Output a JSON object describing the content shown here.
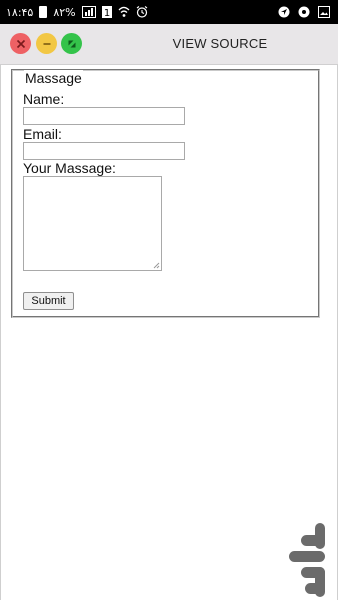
{
  "status_bar": {
    "time": "۱۸:۴۵",
    "battery": "۸۲%",
    "icons": [
      "battery-icon",
      "sim-icon",
      "signal-icon",
      "wifi-icon",
      "alarm-icon",
      "location-icon",
      "settings-icon",
      "gallery-icon"
    ]
  },
  "window": {
    "title": "VIEW SOURCE",
    "controls": [
      "close-icon",
      "minimize-icon",
      "maximize-icon"
    ]
  },
  "form": {
    "legend": "Massage",
    "name_label": "Name:",
    "name_value": "",
    "email_label": "Email:",
    "email_value": "",
    "message_label": "Your Massage:",
    "message_value": "",
    "submit_label": "Submit"
  },
  "colors": {
    "close": "#ee6164",
    "minimize": "#f2c744",
    "maximize": "#34c34a",
    "title_bar": "#e8e6e8",
    "watermark": "#6b6b6b"
  }
}
